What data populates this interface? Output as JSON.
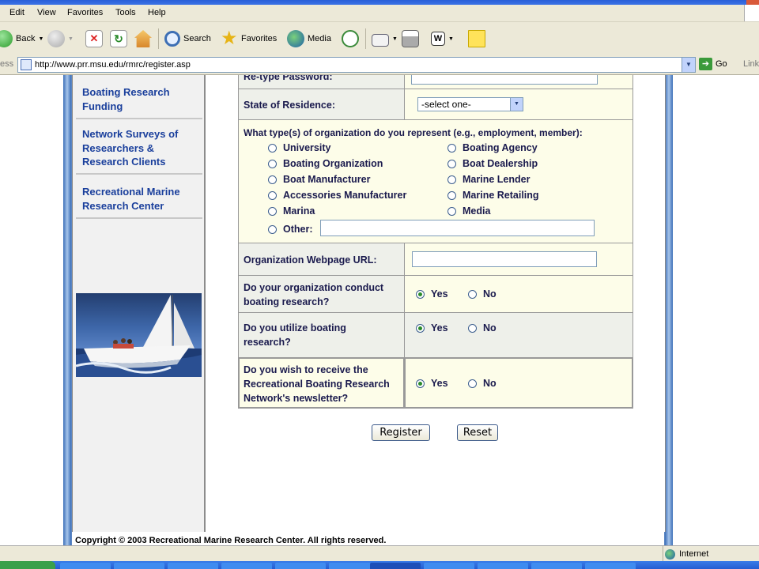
{
  "menu": {
    "items": [
      "Edit",
      "View",
      "Favorites",
      "Tools",
      "Help"
    ]
  },
  "toolbar": {
    "back": "Back",
    "search": "Search",
    "favorites": "Favorites",
    "media": "Media"
  },
  "address": {
    "label": "ess",
    "url": "http://www.prr.msu.edu/rmrc/register.asp",
    "go": "Go",
    "links": "Link"
  },
  "sidebar": {
    "links": [
      "Boating Research Funding",
      "Network Surveys of Researchers & Research Clients",
      "Recreational Marine Research Center"
    ]
  },
  "form": {
    "retype_password_label": "Re-type Password:",
    "state_label": "State of Residence:",
    "state_value": "-select one-",
    "org_type_question": "What type(s) of organization do you represent (e.g., employment, member):",
    "org_types_left": [
      "University",
      "Boating Organization",
      "Boat Manufacturer",
      "Accessories Manufacturer",
      "Marina"
    ],
    "org_types_right": [
      "Boating Agency",
      "Boat Dealership",
      "Marine Lender",
      "Marine Retailing",
      "Media"
    ],
    "other_label": "Other:",
    "webpage_label": "Organization Webpage URL:",
    "q_conduct": "Do your organization conduct boating research?",
    "q_utilize": "Do you utilize boating research?",
    "q_newsletter": "Do you wish to receive the Recreational Boating Research Network's newsletter?",
    "yes": "Yes",
    "no": "No",
    "register": "Register",
    "reset": "Reset"
  },
  "footer": {
    "text": "Copyright © 2003 Recreational Marine Research Center. All rights reserved."
  },
  "status": {
    "zone": "Internet"
  }
}
